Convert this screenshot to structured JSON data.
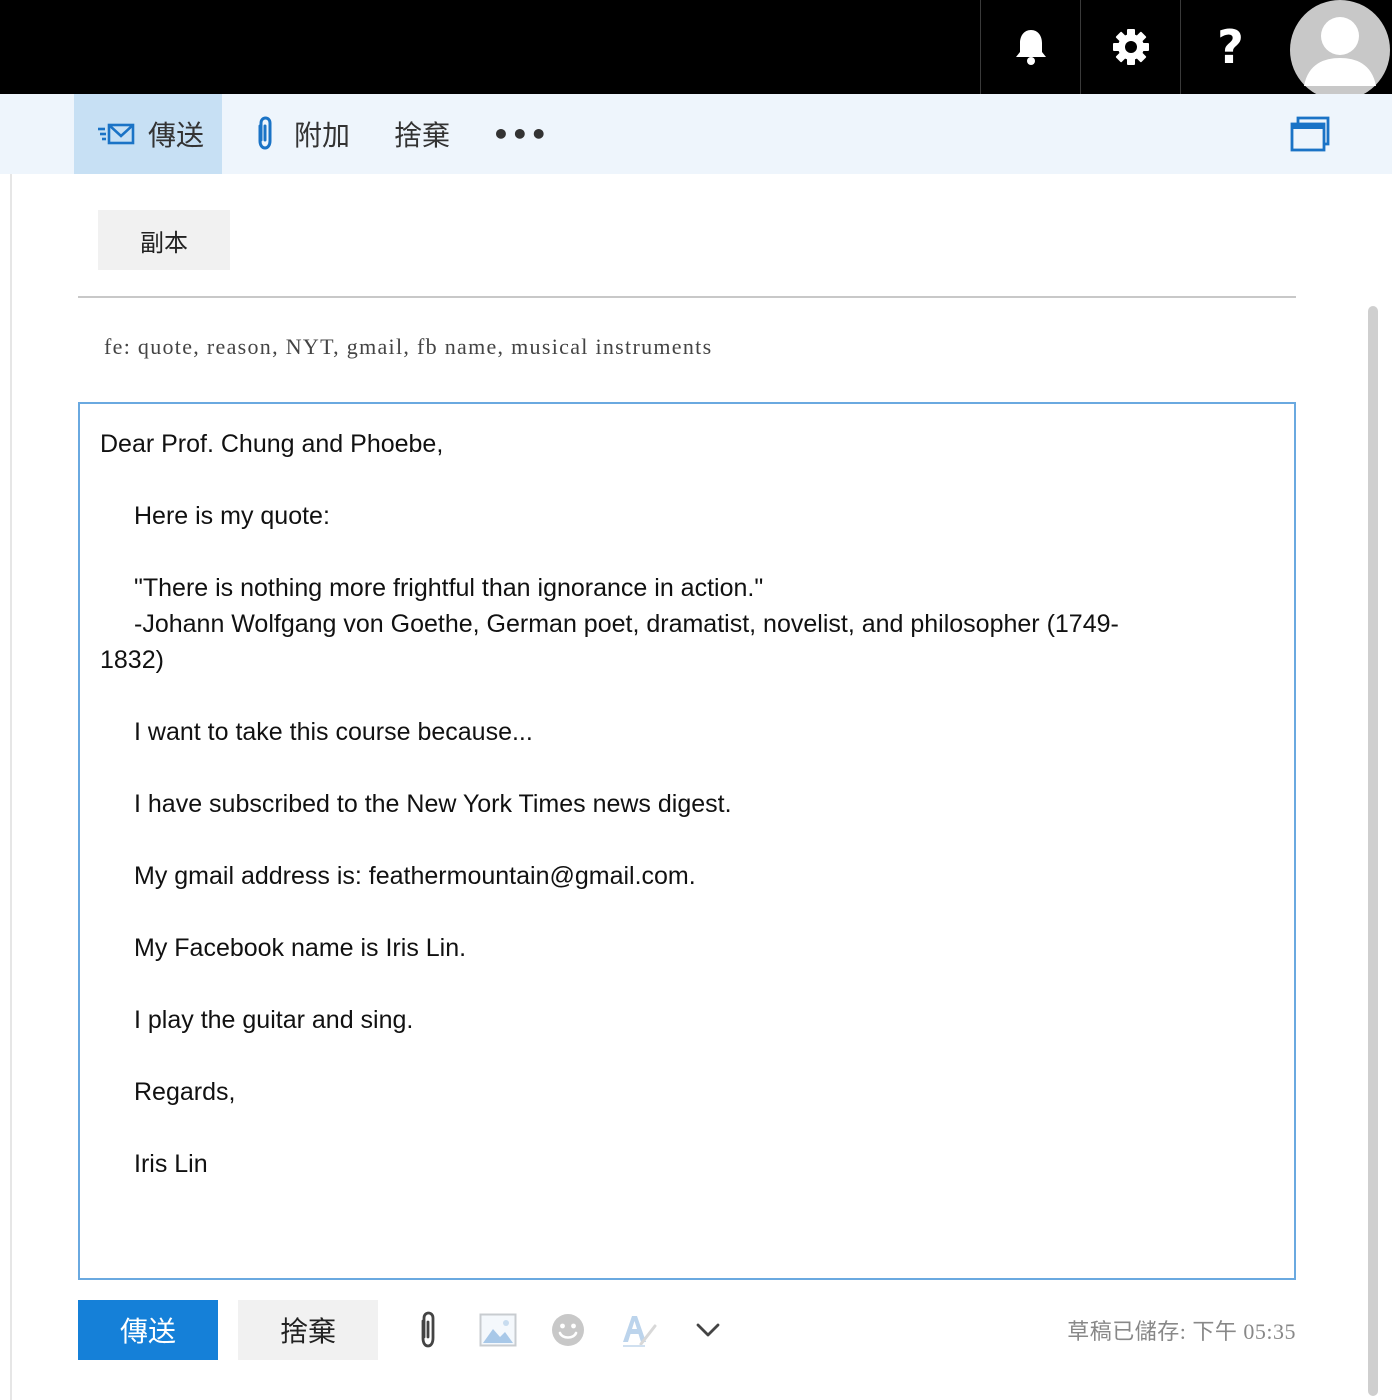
{
  "toolbar": {
    "send_label": "傳送",
    "attach_label": "附加",
    "discard_label": "捨棄",
    "more_label": "•••"
  },
  "header": {
    "help_label": "?"
  },
  "compose": {
    "cc_label": "副本",
    "subject": "fe: quote, reason, NYT, gmail, fb name, musical instruments",
    "body": {
      "greeting": "Dear Prof. Chung and Phoebe,",
      "line1": "Here is my quote:",
      "quote": "\"There is nothing more frightful than ignorance in action.\"",
      "attribution_a": "-Johann Wolfgang von Goethe, German poet, dramatist, novelist, and philosopher (1749-",
      "attribution_b": "1832)",
      "reason": "I want to take this course because...",
      "nyt": "I have subscribed to the New York Times news digest.",
      "gmail": "My gmail address is: feathermountain@gmail.com.",
      "facebook": "My Facebook name is Iris Lin.",
      "music": "I play the guitar and sing.",
      "closing": "Regards,",
      "signature": "Iris Lin"
    }
  },
  "footer": {
    "send_label": "傳送",
    "discard_label": "捨棄",
    "saved_status": "草稿已儲存: 下午 05:35"
  },
  "colors": {
    "accent": "#1580d8",
    "editor_border": "#6aa9e0",
    "command_bar_bg": "#eef5fc",
    "send_tab_bg": "#c7e0f4",
    "topbar_bg": "#000000"
  }
}
